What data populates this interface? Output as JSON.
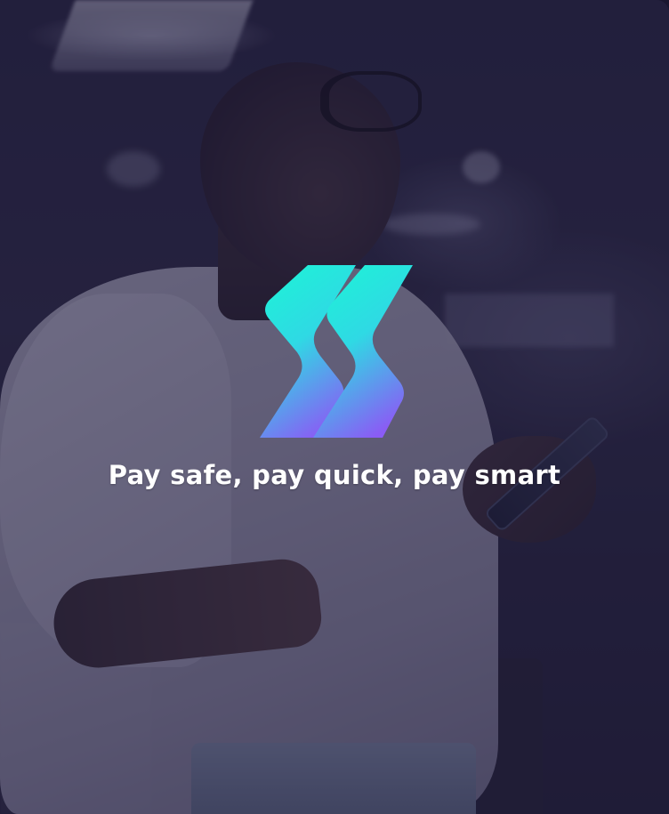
{
  "brand": {
    "tagline": "Pay safe, pay quick, pay smart",
    "logo_colors": {
      "top": "#1ef2d7",
      "bottom": "#8a5cf5"
    }
  },
  "overlay": {
    "color": "#1c1834"
  },
  "icons": {
    "logo": "lightning-s-logo-icon"
  }
}
